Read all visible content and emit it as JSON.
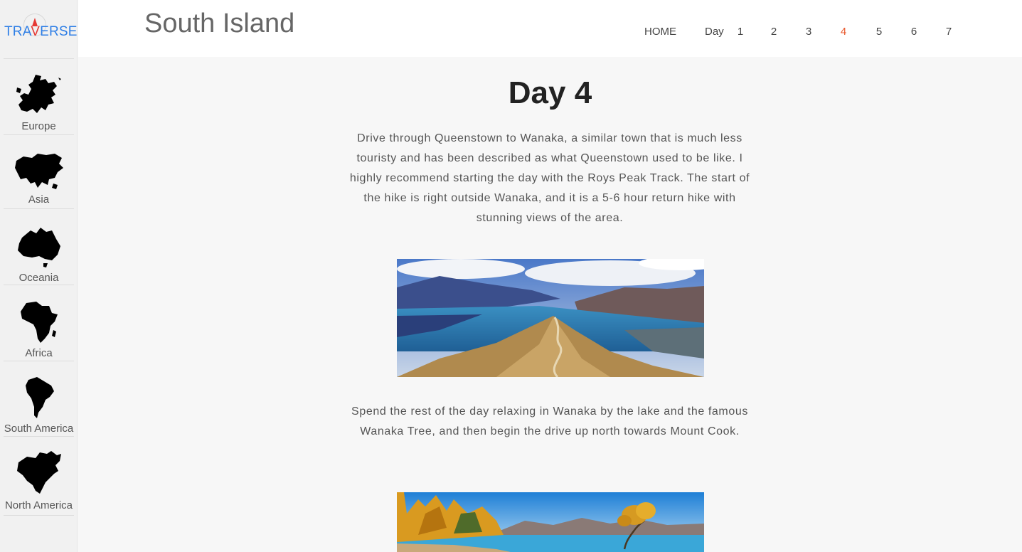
{
  "sidebar": {
    "logo": {
      "text_before": "TRA",
      "text_accent": "V",
      "text_after": "ERSE"
    },
    "items": [
      {
        "label": "Europe",
        "icon": "europe-map-icon"
      },
      {
        "label": "Asia",
        "icon": "asia-map-icon"
      },
      {
        "label": "Oceania",
        "icon": "oceania-map-icon"
      },
      {
        "label": "Africa",
        "icon": "africa-map-icon"
      },
      {
        "label": "South America",
        "icon": "south-america-map-icon"
      },
      {
        "label": "North America",
        "icon": "north-america-map-icon"
      }
    ]
  },
  "header": {
    "title": "South Island",
    "nav": {
      "home": "HOME",
      "day_label": "Day",
      "days": [
        "1",
        "2",
        "3",
        "4",
        "5",
        "6",
        "7"
      ],
      "active_day": "4"
    }
  },
  "main": {
    "title": "Day 4",
    "paragraph_1": "Drive through Queenstown to Wanaka, a similar town that is much less touristy and has been described as what Queenstown used to be like. I highly recommend starting the day with the Roys Peak Track. The start of the hike is right outside Wanaka, and it is a 5-6 hour return hike with stunning views of the area.",
    "paragraph_2": "Spend the rest of the day relaxing in Wanaka by the lake and the famous Wanaka Tree, and then begin the drive up north towards Mount Cook."
  },
  "colors": {
    "accent": "#e8582c",
    "logo_blue": "#2f7fe6",
    "logo_red": "#e53935"
  }
}
